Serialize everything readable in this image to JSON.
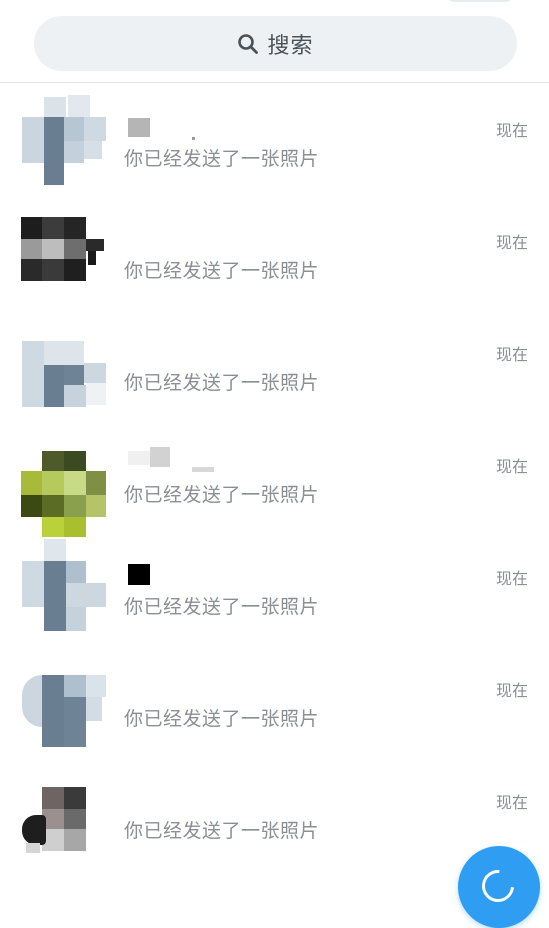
{
  "search": {
    "label": "搜索",
    "icon": "search-icon"
  },
  "chats": [
    {
      "message": "你已经发送了一张照片",
      "time": "现在"
    },
    {
      "message": "你已经发送了一张照片",
      "time": "现在"
    },
    {
      "message": "你已经发送了一张照片",
      "time": "现在"
    },
    {
      "message": "你已经发送了一张照片",
      "time": "现在"
    },
    {
      "message": "你已经发送了一张照片",
      "time": "现在"
    },
    {
      "message": "你已经发送了一张照片",
      "time": "现在"
    },
    {
      "message": "你已经发送了一张照片",
      "time": "现在"
    }
  ],
  "fab": {
    "icon": "new-chat-icon",
    "color": "#2e9df2"
  }
}
